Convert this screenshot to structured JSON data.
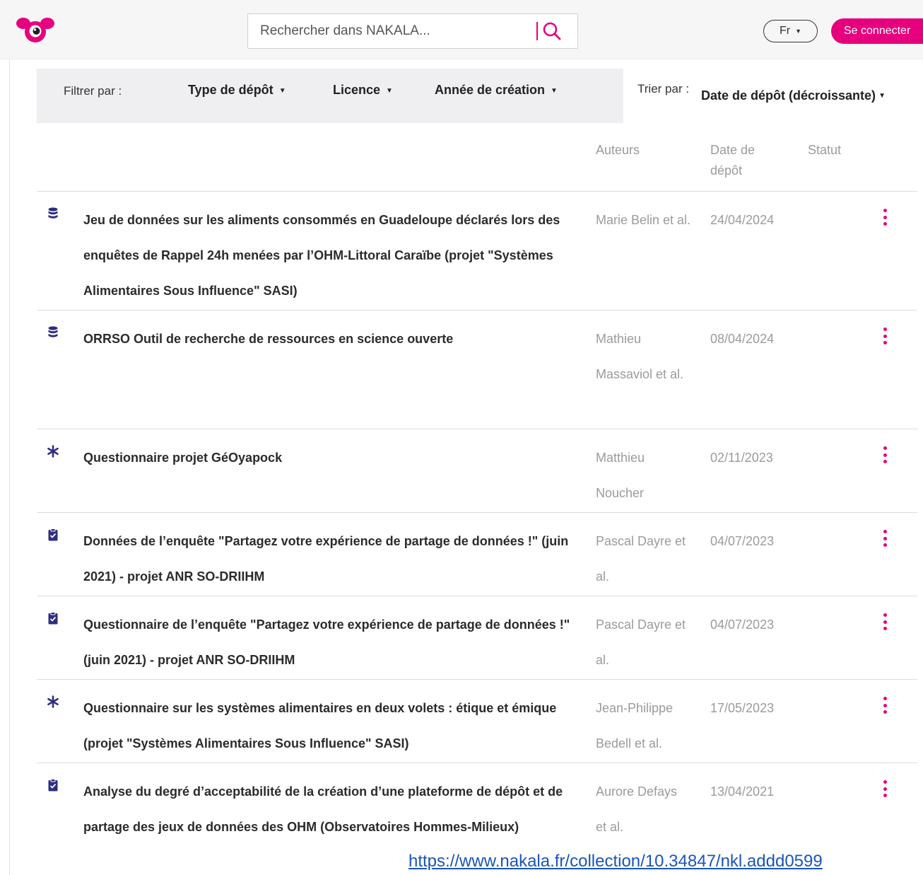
{
  "header": {
    "search_placeholder": "Rechercher dans NAKALA...",
    "lang_label": "Fr",
    "login_label": "Se connecter",
    "logo_icon": "nakala-logo-icon",
    "search_icon": "magnifier-icon"
  },
  "filters": {
    "label": "Filtrer par :",
    "type": "Type de dépôt",
    "licence": "Licence",
    "year": "Année de création",
    "sort_label": "Trier par :",
    "sort_value": "Date de dépôt (décroissante)"
  },
  "columns": {
    "authors": "Auteurs",
    "date": "Date de dépôt",
    "status": "Statut"
  },
  "rows": [
    {
      "icon": "database-icon",
      "title": "Jeu de données sur les aliments consommés en Guadeloupe déclarés lors des enquêtes de Rappel 24h menées par l’OHM-Littoral Caraïbe (projet \"Systèmes Alimentaires Sous Influence\" SASI)",
      "authors": "Marie Belin et al.",
      "date": "24/04/2024"
    },
    {
      "icon": "database-icon",
      "title": "ORRSO Outil de recherche de ressources en science ouverte",
      "authors": "Mathieu Massaviol et al.",
      "date": "08/04/2024"
    },
    {
      "icon": "asterisk-icon",
      "title": "Questionnaire projet GéOyapock",
      "authors": "Matthieu Noucher",
      "date": "02/11/2023"
    },
    {
      "icon": "clipboard-icon",
      "title": "Données de l’enquête \"Partagez votre expérience de partage de données !\" (juin 2021) - projet ANR SO-DRIIHM",
      "authors": "Pascal Dayre et al.",
      "date": "04/07/2023"
    },
    {
      "icon": "clipboard-icon",
      "title": "Questionnaire de l’enquête \"Partagez votre expérience de partage de données !\" (juin 2021) - projet ANR SO-DRIIHM",
      "authors": "Pascal Dayre et al.",
      "date": "04/07/2023"
    },
    {
      "icon": "asterisk-icon",
      "title": "Questionnaire sur les systèmes alimentaires en deux volets : étique et émique (projet \"Systèmes Alimentaires Sous Influence\" SASI)",
      "authors": "Jean-Philippe Bedell et al.",
      "date": "17/05/2023"
    },
    {
      "icon": "clipboard-icon",
      "title": "Analyse du degré d’acceptabilité de la création d’une plateforme de dépôt et de partage des jeux de données des OHM (Observatoires Hommes-Milieux)",
      "authors": "Aurore Defays et al.",
      "date": "13/04/2021"
    }
  ],
  "footer_url": "https://www.nakala.fr/collection/10.34847/nkl.addd0599",
  "colors": {
    "accent": "#e6007e",
    "icon": "#2e2e80",
    "muted_text": "#9b9b9b"
  }
}
